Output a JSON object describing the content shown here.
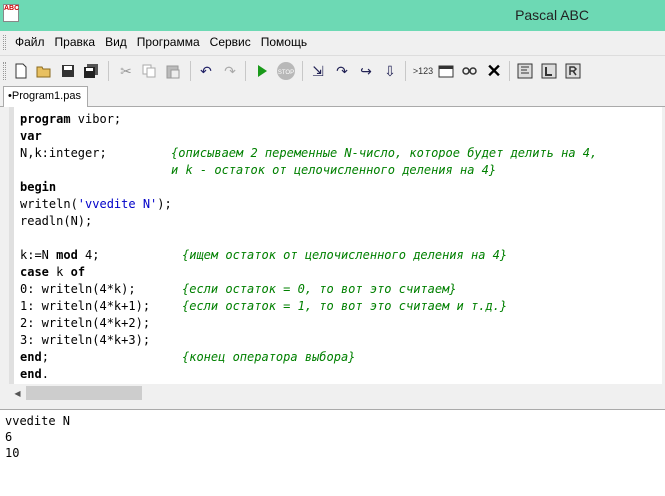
{
  "window": {
    "title": "Pascal ABC",
    "icon_text": "ABC"
  },
  "menu": [
    "Файл",
    "Правка",
    "Вид",
    "Программа",
    "Сервис",
    "Помощь"
  ],
  "toolbar": {
    "stop_label": "STOP",
    "view_label": ">123"
  },
  "tab": {
    "label": "•Program1.pas"
  },
  "code": {
    "l1_kw": "program",
    "l1_rest": " vibor;",
    "l2_kw": "var",
    "l3": "N,k:integer;",
    "l3_cmt": "{описываем 2 переменные N-число, которое будет делить на 4,",
    "l4_cmt": "и k - остаток от целочисленного деления на 4}",
    "l5_kw": "begin",
    "l6_a": "writeln(",
    "l6_str": "'vvedite N'",
    "l6_b": ");",
    "l7": "readln(N);",
    "l9_a": "k:=N ",
    "l9_kw": "mod",
    "l9_b": " 4;",
    "l9_cmt": "{ищем остаток от целочисленного деления на 4}",
    "l10_kw1": "case",
    "l10_mid": " k ",
    "l10_kw2": "of",
    "l11": "0: writeln(4*k);",
    "l11_cmt": "{если остаток = 0, то вот это считаем}",
    "l12": "1: writeln(4*k+1);",
    "l12_cmt": "{если остаток = 1, то вот это считаем и т.д.}",
    "l13": "2: writeln(4*k+2);",
    "l14": "3: writeln(4*k+3);",
    "l15_kw": "end",
    "l15_rest": ";",
    "l15_cmt": "{конец оператора выбора}",
    "l16_kw": "end",
    "l16_rest": "."
  },
  "output": [
    "vvedite N",
    "6",
    "10"
  ]
}
